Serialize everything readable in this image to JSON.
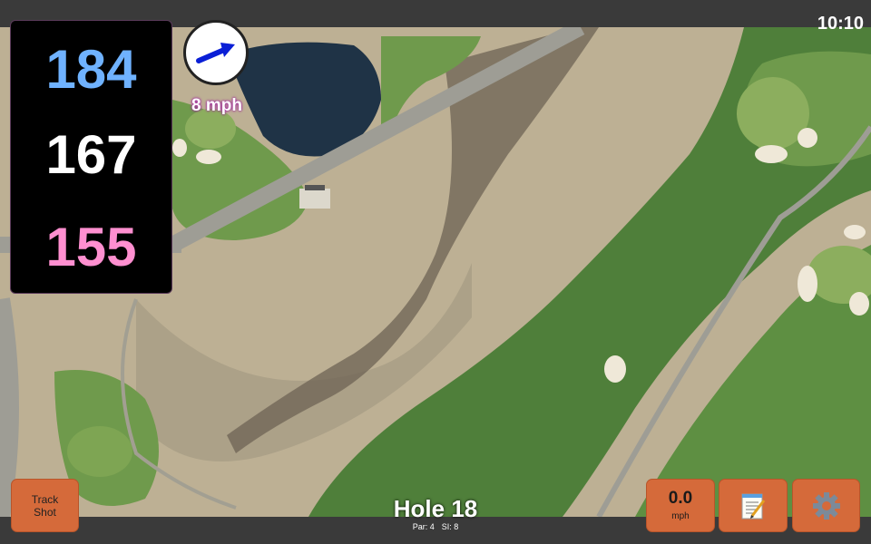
{
  "status": {
    "time": "10:10"
  },
  "yardages": {
    "back": "184",
    "center": "167",
    "front": "155"
  },
  "wind": {
    "speed": "8 mph",
    "icon": "wind-arrow-icon"
  },
  "hole": {
    "title": "Hole 18",
    "par": "Par: 4",
    "si": "SI: 8"
  },
  "buttons": {
    "track_shot": "Track Shot",
    "speed_value": "0.0",
    "speed_unit": "mph",
    "notes_icon": "notepad-icon",
    "settings_icon": "gear-icon"
  },
  "colors": {
    "back": "#6fb2ff",
    "center": "#ffffff",
    "front": "#ff8fd0",
    "button": "#d56a3a",
    "wind_arrow": "#0a1fd6"
  }
}
